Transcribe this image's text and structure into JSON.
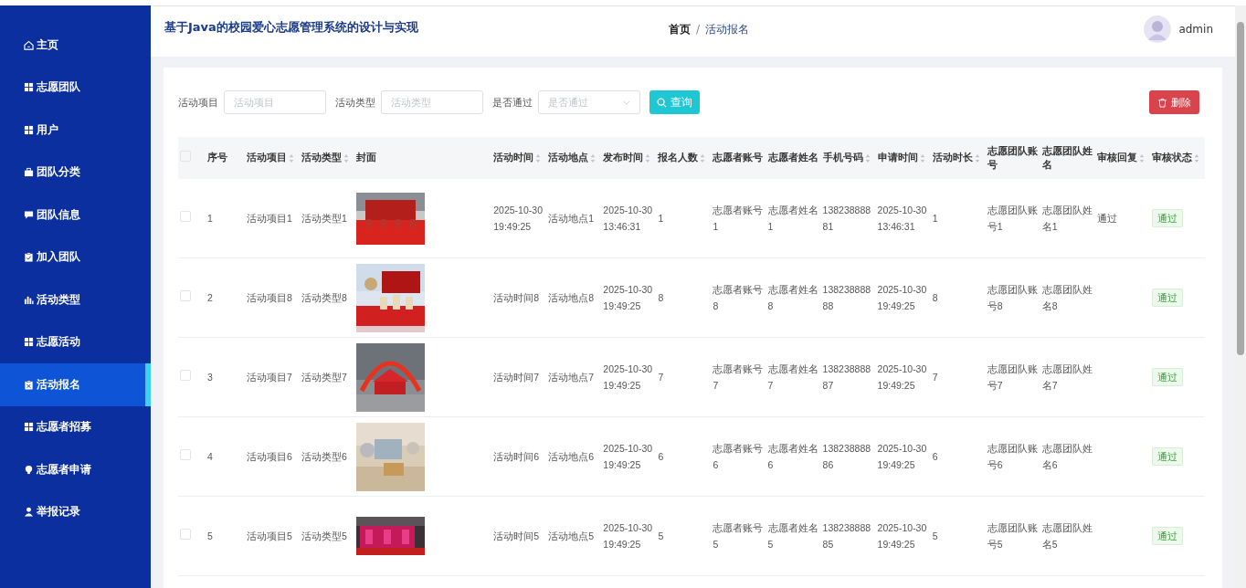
{
  "sidebar": {
    "items": [
      {
        "label": "主页",
        "selected": false
      },
      {
        "label": "志愿团队",
        "selected": false
      },
      {
        "label": "用户",
        "selected": false
      },
      {
        "label": "团队分类",
        "selected": false
      },
      {
        "label": "团队信息",
        "selected": false
      },
      {
        "label": "加入团队",
        "selected": false
      },
      {
        "label": "活动类型",
        "selected": false
      },
      {
        "label": "志愿活动",
        "selected": false
      },
      {
        "label": "活动报名",
        "selected": true
      },
      {
        "label": "志愿者招募",
        "selected": false
      },
      {
        "label": "志愿者申请",
        "selected": false
      },
      {
        "label": "举报记录",
        "selected": false
      }
    ]
  },
  "header": {
    "title": "基于Java的校园爱心志愿管理系统的设计与实现",
    "breadcrumb": {
      "items": [
        "首页",
        "活动报名"
      ],
      "separator": "/"
    },
    "user": "admin"
  },
  "search": {
    "fields": [
      {
        "kind": "input",
        "label": "活动项目",
        "placeholder": "活动项目"
      },
      {
        "kind": "input",
        "label": "活动类型",
        "placeholder": "活动类型"
      },
      {
        "kind": "select",
        "label": "是否通过",
        "placeholder": "是否通过"
      }
    ],
    "query_button": "查询",
    "delete_button": "删除"
  },
  "table": {
    "columns": [
      {
        "kind": "checkbox",
        "checked": false
      },
      {
        "label": "序号",
        "sortable": false
      },
      {
        "label": "活动项目",
        "sortable": true
      },
      {
        "label": "活动类型",
        "sortable": true
      },
      {
        "label": "封面",
        "sortable": false
      },
      {
        "label": "活动时间",
        "sortable": true
      },
      {
        "label": "活动地点",
        "sortable": true
      },
      {
        "label": "发布时间",
        "sortable": true
      },
      {
        "label": "报名人数",
        "sortable": true
      },
      {
        "label": "志愿者账号",
        "sortable": false
      },
      {
        "label": "志愿者姓名",
        "sortable": false
      },
      {
        "label": "手机号码",
        "sortable": true
      },
      {
        "label": "申请时间",
        "sortable": true
      },
      {
        "label": "活动时长",
        "sortable": true
      },
      {
        "label": "志愿团队账号",
        "sortable": false
      },
      {
        "label": "志愿团队姓名",
        "sortable": false
      },
      {
        "label": "审核回复",
        "sortable": true
      },
      {
        "label": "审核状态",
        "sortable": true
      }
    ],
    "rows": [
      {
        "cells": [
          {
            "kind": "checkbox",
            "checked": false
          },
          "1",
          "活动项目1",
          "活动类型1",
          {
            "kind": "picture"
          },
          "2025-10-30 19:49:25",
          "活动地点1",
          "2025-10-30 13:46:31",
          "1",
          "志愿者账号1",
          "志愿者姓名1",
          "13823888881",
          "2025-10-30 13:46:31",
          "1",
          "志愿团队账号1",
          "志愿团队姓名1",
          "通过",
          {
            "kind": "tag",
            "text": "通过"
          }
        ]
      },
      {
        "cells": [
          {
            "kind": "checkbox",
            "checked": false
          },
          "2",
          "活动项目8",
          "活动类型8",
          {
            "kind": "picture"
          },
          "活动时间8",
          "活动地点8",
          "2025-10-30 19:49:25",
          "8",
          "志愿者账号8",
          "志愿者姓名8",
          "13823888888",
          "2025-10-30 19:49:25",
          "8",
          "志愿团队账号8",
          "志愿团队姓名8",
          null,
          {
            "kind": "tag",
            "text": "通过"
          }
        ]
      },
      {
        "cells": [
          {
            "kind": "checkbox",
            "checked": false
          },
          "3",
          "活动项目7",
          "活动类型7",
          {
            "kind": "picture"
          },
          "活动时间7",
          "活动地点7",
          "2025-10-30 19:49:25",
          "7",
          "志愿者账号7",
          "志愿者姓名7",
          "13823888887",
          "2025-10-30 19:49:25",
          "7",
          "志愿团队账号7",
          "志愿团队姓名7",
          null,
          {
            "kind": "tag",
            "text": "通过"
          }
        ]
      },
      {
        "cells": [
          {
            "kind": "checkbox",
            "checked": false
          },
          "4",
          "活动项目6",
          "活动类型6",
          {
            "kind": "picture"
          },
          "活动时间6",
          "活动地点6",
          "2025-10-30 19:49:25",
          "6",
          "志愿者账号6",
          "志愿者姓名6",
          "13823888886",
          "2025-10-30 19:49:25",
          "6",
          "志愿团队账号6",
          "志愿团队姓名6",
          null,
          {
            "kind": "tag",
            "text": "通过"
          }
        ]
      },
      {
        "cells": [
          {
            "kind": "checkbox",
            "checked": false
          },
          "5",
          "活动项目5",
          "活动类型5",
          {
            "kind": "picture"
          },
          "活动时间5",
          "活动地点5",
          "2025-10-30 19:49:25",
          "5",
          "志愿者账号5",
          "志愿者姓名5",
          "13823888885",
          "2025-10-30 19:49:25",
          "5",
          "志愿团队账号5",
          "志愿团队姓名5",
          null,
          {
            "kind": "tag",
            "text": "通过"
          }
        ]
      }
    ]
  }
}
